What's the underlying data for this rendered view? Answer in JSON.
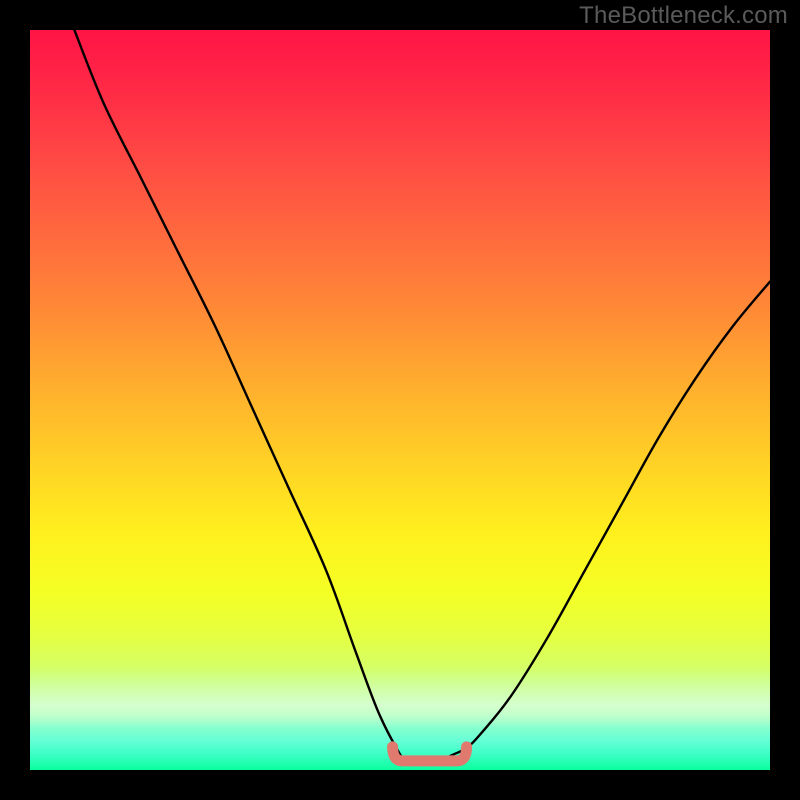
{
  "watermark": "TheBottleneck.com",
  "colors": {
    "curve": "#000000",
    "bump": "#e07a6e",
    "background_top": "#ff1446",
    "background_bottom": "#0aff9c",
    "frame": "#000000"
  },
  "chart_data": {
    "type": "line",
    "title": "",
    "xlabel": "",
    "ylabel": "",
    "xlim": [
      0,
      100
    ],
    "ylim": [
      0,
      100
    ],
    "grid": false,
    "legend": false,
    "series": [
      {
        "name": "bottleneck-curve",
        "x": [
          6,
          10,
          15,
          20,
          25,
          30,
          35,
          40,
          44,
          47,
          49.5,
          51,
          53,
          55,
          57,
          59,
          61,
          65,
          70,
          75,
          80,
          85,
          90,
          95,
          100
        ],
        "y": [
          100,
          90,
          80,
          70,
          60,
          49,
          38,
          27,
          16,
          8,
          3,
          1,
          1,
          1,
          2,
          3,
          5,
          10,
          18,
          27,
          36,
          45,
          53,
          60,
          66
        ]
      }
    ],
    "annotations": [
      {
        "name": "optimal-zone-bump",
        "shape": "rounded-segment",
        "x_start": 49,
        "x_end": 59,
        "y": 1.5
      }
    ]
  }
}
